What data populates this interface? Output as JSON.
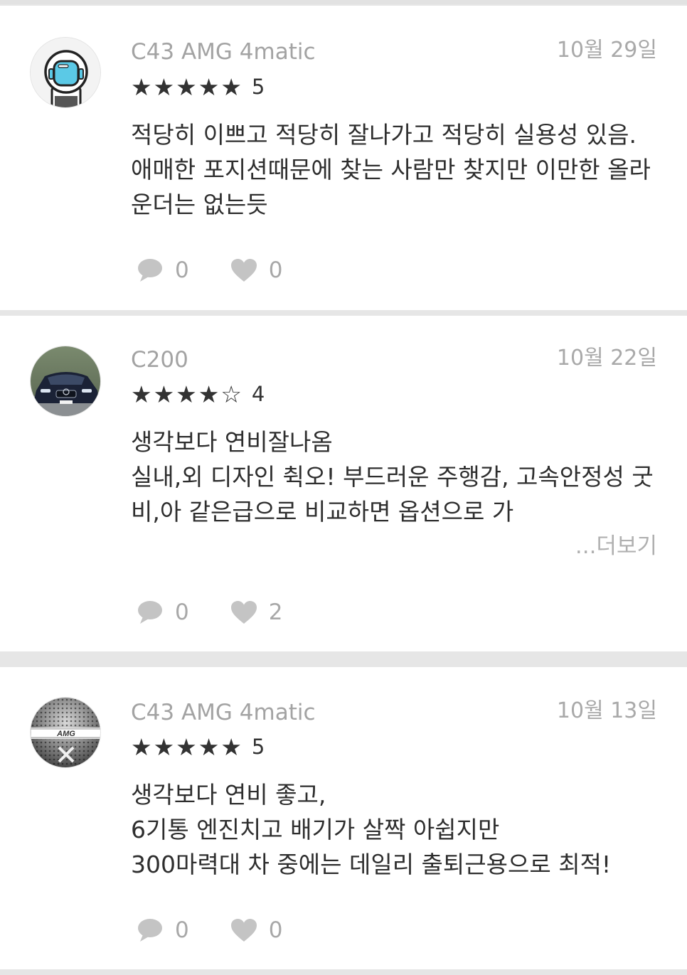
{
  "reviews": [
    {
      "model": "C43 AMG 4matic",
      "date": "10월 29일",
      "stars": "★★★★★",
      "rating": "5",
      "text": "적당히 이쁘고 적당히 잘나가고 적당히 실용성 있음. 애매한 포지션때문에 찾는 사람만 찾지만 이만한 올라운더는 없는듯",
      "comments": "0",
      "likes": "0",
      "avatar_icon": "astronaut-avatar"
    },
    {
      "model": "C200",
      "date": "10월 22일",
      "stars": "★★★★☆",
      "rating": "4",
      "text": "생각보다 연비잘나옴\n실내,외 디자인 췩오! 부드러운 주행감, 고속안정성 굿\n비,아 같은급으로 비교하면 옵션으로 가",
      "more": "...더보기",
      "comments": "0",
      "likes": "2",
      "avatar_icon": "car-photo-avatar"
    },
    {
      "model": "C43 AMG 4matic",
      "date": "10월 13일",
      "stars": "★★★★★",
      "rating": "5",
      "text": "생각보다 연비 좋고,\n6기통 엔진치고 배기가 살짝 아쉽지만\n300마력대 차 중에는 데일리 출퇴근용으로 최적!",
      "comments": "0",
      "likes": "0",
      "avatar_icon": "amg-badge-avatar",
      "avatar_text": "AMG"
    }
  ],
  "colors": {
    "background": "#e6e6e6",
    "card": "#ffffff",
    "meta_text": "#a3a3a3",
    "body_text": "#2e2e2e",
    "icon_gray": "#c4c4c4",
    "astronaut_visor": "#5bc9e6"
  },
  "icons": {
    "comment": "comment-bubble-icon",
    "like": "heart-icon",
    "star": "star-icon"
  }
}
